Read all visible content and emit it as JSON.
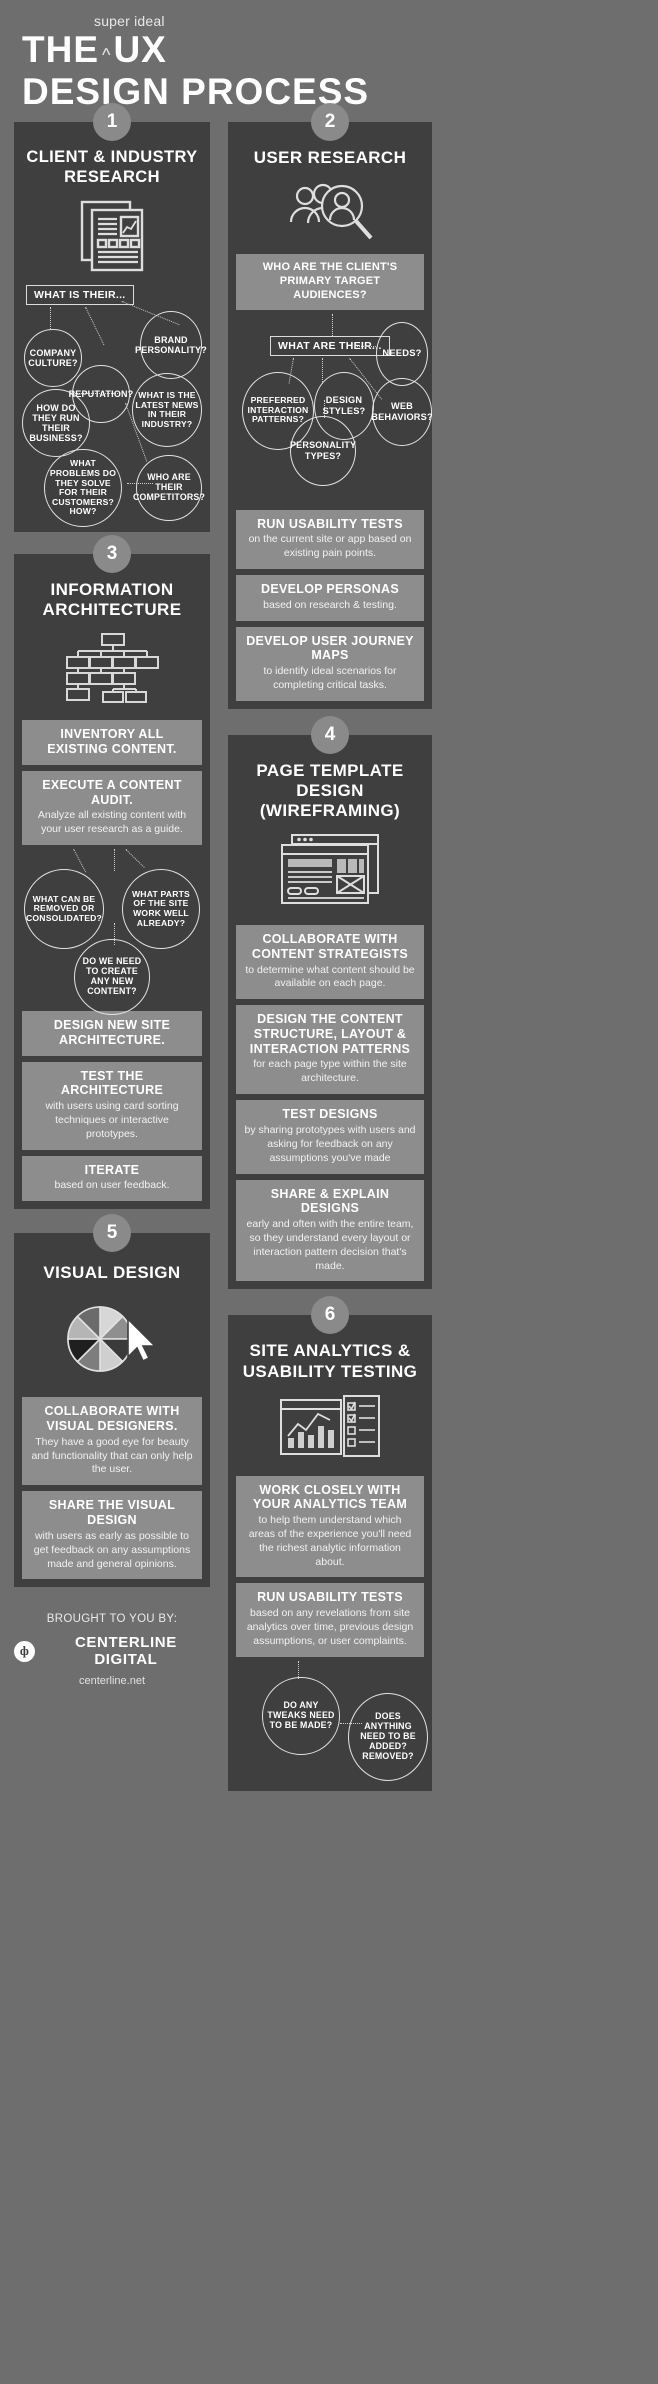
{
  "header": {
    "kicker": "super ideal",
    "caret": "^",
    "line1_a": "THE",
    "line1_b": "UX",
    "line2": "DESIGN PROCESS"
  },
  "steps": [
    {
      "number": "1",
      "title": "CLIENT & INDUSTRY RESEARCH",
      "icon": "document-report-icon",
      "query": "WHAT IS THEIR...",
      "bubbles": [
        "COMPANY CULTURE?",
        "REPUTATION?",
        "BRAND PERSONALITY?",
        "HOW DO THEY RUN THEIR BUSINESS?",
        "WHAT IS THE LATEST NEWS IN THEIR INDUSTRY?",
        "WHAT PROBLEMS DO  THEY SOLVE FOR THEIR CUSTOMERS? HOW?",
        "WHO ARE THEIR COMPETITORS?"
      ],
      "tips": []
    },
    {
      "number": "2",
      "title": "USER RESEARCH",
      "icon": "users-magnifier-icon",
      "band": "WHO ARE THE CLIENT'S PRIMARY TARGET AUDIENCES?",
      "query": "WHAT ARE THEIR...",
      "bubbles": [
        "NEEDS?",
        "PREFERRED INTERACTION PATTERNS?",
        "DESIGN STYLES?",
        "WEB BEHAVIORS?",
        "PERSONALITY TYPES?"
      ],
      "tips": [
        {
          "head": "RUN USABILITY TESTS",
          "body": "on the current site or app based on existing pain points."
        },
        {
          "head": "DEVELOP PERSONAS",
          "body": "based on research & testing."
        },
        {
          "head": "DEVELOP USER JOURNEY MAPS",
          "body": "to identify ideal scenarios for completing critical tasks."
        }
      ]
    },
    {
      "number": "3",
      "title": "INFORMATION ARCHITECTURE",
      "icon": "sitemap-icon",
      "tip_top": {
        "head": "INVENTORY ALL EXISTING CONTENT.",
        "body": ""
      },
      "tip_audit": {
        "head": "EXECUTE A CONTENT AUDIT.",
        "body": "Analyze all existing content with your user research as a guide."
      },
      "bubbles": [
        "WHAT CAN BE REMOVED OR CONSOLIDATED?",
        "WHAT PARTS OF THE SITE WORK WELL ALREADY?",
        "DO WE NEED TO CREATE ANY NEW CONTENT?"
      ],
      "tips": [
        {
          "head": "DESIGN NEW SITE ARCHITECTURE.",
          "body": ""
        },
        {
          "head": "TEST THE ARCHITECTURE",
          "body": "with users using card sorting techniques or interactive prototypes."
        },
        {
          "head": "ITERATE",
          "body": "based on user feedback."
        }
      ]
    },
    {
      "number": "4",
      "title": "PAGE TEMPLATE DESIGN (WIREFRAMING)",
      "icon": "wireframe-browser-icon",
      "tips": [
        {
          "head": "COLLABORATE WITH CONTENT STRATEGISTS",
          "body": "to determine what content should be available on each page."
        },
        {
          "head": "DESIGN THE CONTENT STRUCTURE, LAYOUT & INTERACTION PATTERNS",
          "body": "for each page type within the site architecture."
        },
        {
          "head": "TEST DESIGNS",
          "body": "by sharing prototypes with users and asking for feedback on any assumptions you've made"
        },
        {
          "head": "SHARE & EXPLAIN DESIGNS",
          "body": "early and often with the entire team, so they understand every layout or interaction pattern decision that's made."
        }
      ]
    },
    {
      "number": "5",
      "title": "VISUAL DESIGN",
      "icon": "pie-chart-cursor-icon",
      "tips": [
        {
          "head": "COLLABORATE WITH VISUAL DESIGNERS.",
          "body": "They have a good eye for beauty and functionality that can only help the user."
        },
        {
          "head": "SHARE THE VISUAL DESIGN",
          "body": "with users as early as possible to get feedback on any assumptions made and general opinions."
        }
      ]
    },
    {
      "number": "6",
      "title": "SITE ANALYTICS & USABILITY TESTING",
      "icon": "analytics-checklist-icon",
      "tips": [
        {
          "head": "WORK CLOSELY WITH YOUR ANALYTICS TEAM",
          "body": "to help them understand which areas of the experience you'll need the richest analytic information about."
        },
        {
          "head": "RUN USABILITY TESTS",
          "body": "based on any revelations from site analytics over time, previous design assumptions, or user complaints."
        }
      ],
      "bubbles": [
        "DO ANY TWEAKS NEED TO BE MADE?",
        "DOES ANYTHING NEED TO BE ADDED? REMOVED?"
      ]
    }
  ],
  "footer": {
    "lead": "BROUGHT TO YOU BY:",
    "brand_mark": "ф",
    "brand": "CENTERLINE DIGITAL",
    "url": "centerline.net"
  },
  "colors": {
    "page_bg": "#6e6e6e",
    "panel_bg": "#3f3f3f",
    "tip_bg": "#8d8d8d",
    "badge_bg": "#8a8a8a",
    "text": "#ffffff"
  }
}
